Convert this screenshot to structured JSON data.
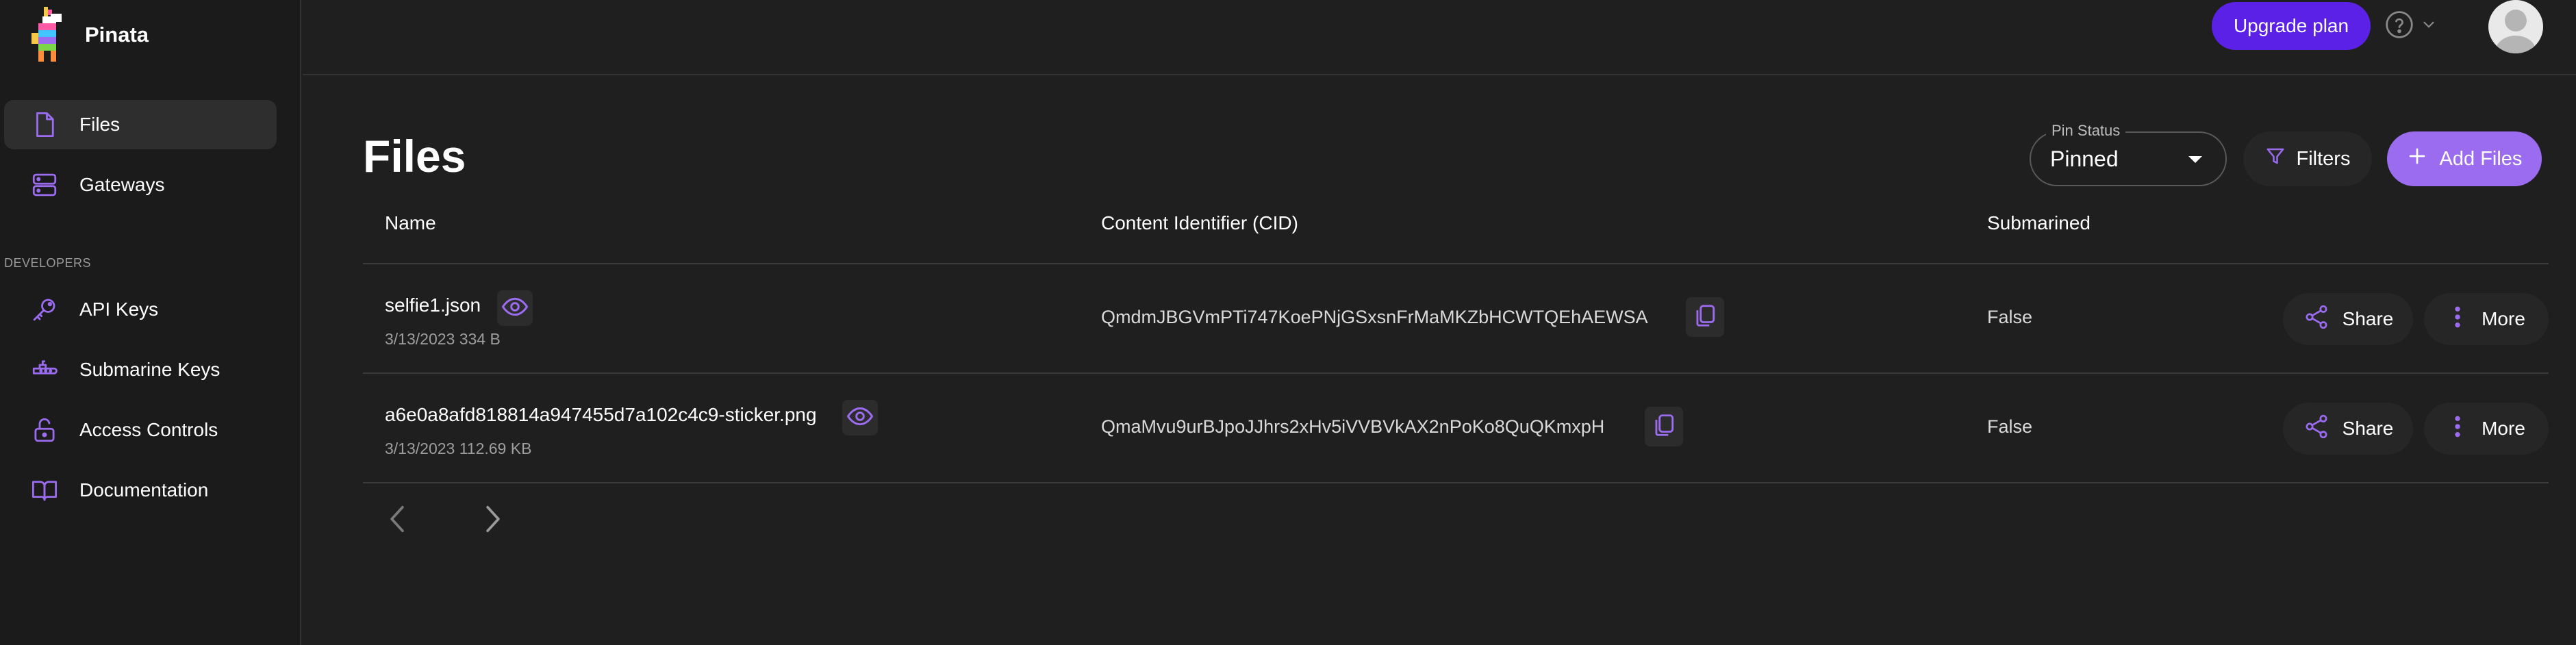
{
  "app": {
    "name": "Pinata"
  },
  "colors": {
    "accent": "#9b6cf0",
    "upgrade": "#5b21e6",
    "background": "#1f1f1f"
  },
  "sidebar": {
    "items": [
      {
        "label": "Files",
        "icon": "file-icon",
        "active": true
      },
      {
        "label": "Gateways",
        "icon": "server-icon"
      }
    ],
    "developers_label": "DEVELOPERS",
    "dev_items": [
      {
        "label": "API Keys",
        "icon": "key-icon"
      },
      {
        "label": "Submarine Keys",
        "icon": "submarine-icon"
      },
      {
        "label": "Access Controls",
        "icon": "lock-icon"
      },
      {
        "label": "Documentation",
        "icon": "book-icon"
      }
    ]
  },
  "topbar": {
    "upgrade_label": "Upgrade plan",
    "help_icon": "help-icon",
    "avatar": "avatar"
  },
  "main": {
    "title": "Files",
    "pin_status": {
      "legend": "Pin Status",
      "value": "Pinned"
    },
    "filters_label": "Filters",
    "add_files_label": "Add Files"
  },
  "table": {
    "columns": [
      "Name",
      "Content Identifier (CID)",
      "Submarined"
    ],
    "rows": [
      {
        "name": "selfie1.json",
        "meta": "3/13/2023 334 B",
        "cid": "QmdmJBGVmPTi747KoePNjGSxsnFrMaMKZbHCWTQEhAEWSA",
        "submarined": "False",
        "share_label": "Share",
        "more_label": "More"
      },
      {
        "name": "a6e0a8afd818814a947455d7a102c4c9-sticker.png",
        "meta": "3/13/2023 112.69 KB",
        "cid": "QmaMvu9urBJpoJJhrs2xHv5iVVBVkAX2nPoKo8QuQKmxpH",
        "submarined": "False",
        "share_label": "Share",
        "more_label": "More"
      }
    ]
  },
  "pagination": {
    "prev_icon": "chevron-left-icon",
    "next_icon": "chevron-right-icon"
  }
}
